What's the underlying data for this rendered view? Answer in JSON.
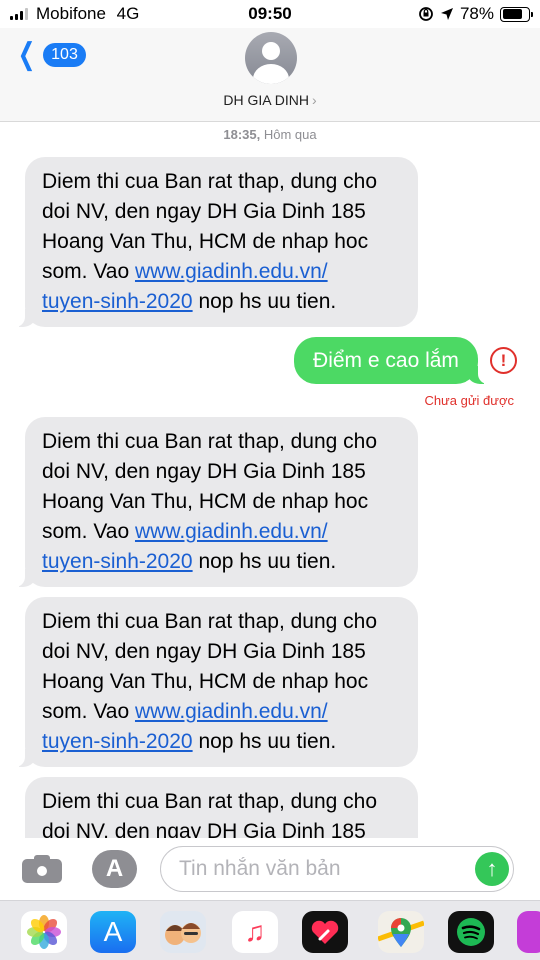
{
  "status_bar": {
    "carrier": "Mobifone",
    "network": "4G",
    "time": "09:50",
    "battery_percent": "78%",
    "battery_level": 0.78,
    "signal_bars": 3,
    "signal_bars_total": 4
  },
  "header": {
    "back_badge": "103",
    "contact_name": "DH GIA DINH"
  },
  "conversation": {
    "timestamp_time": "18:35,",
    "timestamp_day": "Hôm qua",
    "incoming_template": {
      "line_1": "Diem thi cua Ban rat thap, dung cho",
      "line_2": "doi NV, den ngay DH Gia Dinh 185",
      "line_3": "Hoang Van Thu, HCM de nhap hoc",
      "line_4_prefix": "som. Vao ",
      "link_part_1": "www.giadinh.edu.vn/",
      "link_part_2": "tuyen-sinh-2020",
      "line_5_suffix": " nop hs uu tien."
    },
    "outgoing_message": "Điểm e cao lắm",
    "error_mark": "!",
    "not_delivered": "Chưa gửi được"
  },
  "input_bar": {
    "placeholder": "Tin nhắn văn bản",
    "value": ""
  },
  "colors": {
    "ios_blue": "#1a7cf5",
    "sms_green": "#4cd964",
    "incoming_gray": "#e9e9eb",
    "error_red": "#e0302b"
  },
  "icons": {
    "back": "chevron-left-icon",
    "camera": "camera-icon",
    "apps": "app-store-icon",
    "send": "arrow-up-icon",
    "error": "exclamation-circle-icon",
    "drawer": [
      "photos-icon",
      "app-store-icon",
      "memoji-icon",
      "music-icon",
      "digital-touch-icon",
      "maps-icon",
      "spotify-icon",
      "more-app-icon"
    ]
  }
}
